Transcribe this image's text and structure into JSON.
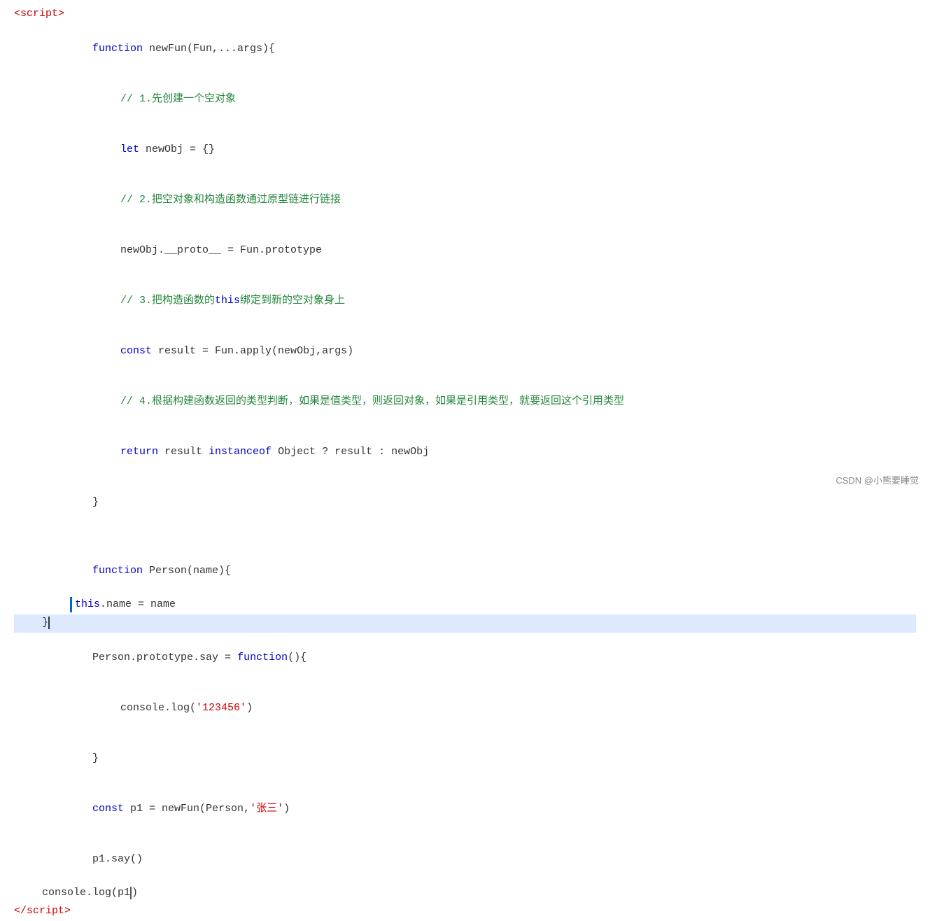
{
  "code": {
    "lines": [
      {
        "id": "script-open",
        "indent": 0,
        "content": "&lt;script&gt;",
        "type": "tag"
      },
      {
        "id": "line-fn1",
        "indent": 1,
        "content": "function newFun(Fun,...args){",
        "type": "code"
      },
      {
        "id": "line-comment1",
        "indent": 2,
        "content": "// 1.先创建一个空对象",
        "type": "comment"
      },
      {
        "id": "line-let",
        "indent": 2,
        "content": "let newObj = {}",
        "type": "code"
      },
      {
        "id": "line-comment2",
        "indent": 2,
        "content": "// 2.把空对象和构造函数通过原型链进行链接",
        "type": "comment"
      },
      {
        "id": "line-proto",
        "indent": 2,
        "content": "newObj.__proto__ = Fun.prototype",
        "type": "code"
      },
      {
        "id": "line-comment3",
        "indent": 2,
        "content": "// 3.把构造函数的this绑定到新的空对象身上",
        "type": "comment"
      },
      {
        "id": "line-const-result",
        "indent": 2,
        "content": "const result = Fun.apply(newObj,args)",
        "type": "code"
      },
      {
        "id": "line-comment4",
        "indent": 2,
        "content": "// 4.根据构建函数返回的类型判断，如果是值类型，则返回对象，如果是引用类型，就要返回这个引用类型",
        "type": "comment"
      },
      {
        "id": "line-return",
        "indent": 2,
        "content": "return result instanceof Object ? result : newObj",
        "type": "code"
      },
      {
        "id": "line-close1",
        "indent": 1,
        "content": "}",
        "type": "code"
      },
      {
        "id": "line-empty1",
        "indent": 0,
        "content": "",
        "type": "empty"
      },
      {
        "id": "line-fn2",
        "indent": 1,
        "content": "function Person(name){",
        "type": "code"
      },
      {
        "id": "line-this",
        "indent": 2,
        "content": "this.name = name",
        "type": "code"
      },
      {
        "id": "line-close2",
        "indent": 1,
        "content": "}",
        "type": "code",
        "cursor": true,
        "highlighted": true
      },
      {
        "id": "line-proto-say",
        "indent": 1,
        "content": "Person.prototype.say = function(){",
        "type": "code"
      },
      {
        "id": "line-console-log",
        "indent": 2,
        "content": "console.log('123456')",
        "type": "code"
      },
      {
        "id": "line-close3",
        "indent": 1,
        "content": "}",
        "type": "code"
      },
      {
        "id": "line-const-p1",
        "indent": 1,
        "content": "const p1 = newFun(Person,'张三')",
        "type": "code"
      },
      {
        "id": "line-p1-say",
        "indent": 1,
        "content": "p1.say()",
        "type": "code"
      },
      {
        "id": "line-console-p1",
        "indent": 1,
        "content": "console.log(p1)",
        "type": "code"
      },
      {
        "id": "script-close",
        "indent": 0,
        "content": "&lt;/script&gt;",
        "type": "tag"
      }
    ],
    "watermark": "CSDN @小熊要睡觉"
  }
}
